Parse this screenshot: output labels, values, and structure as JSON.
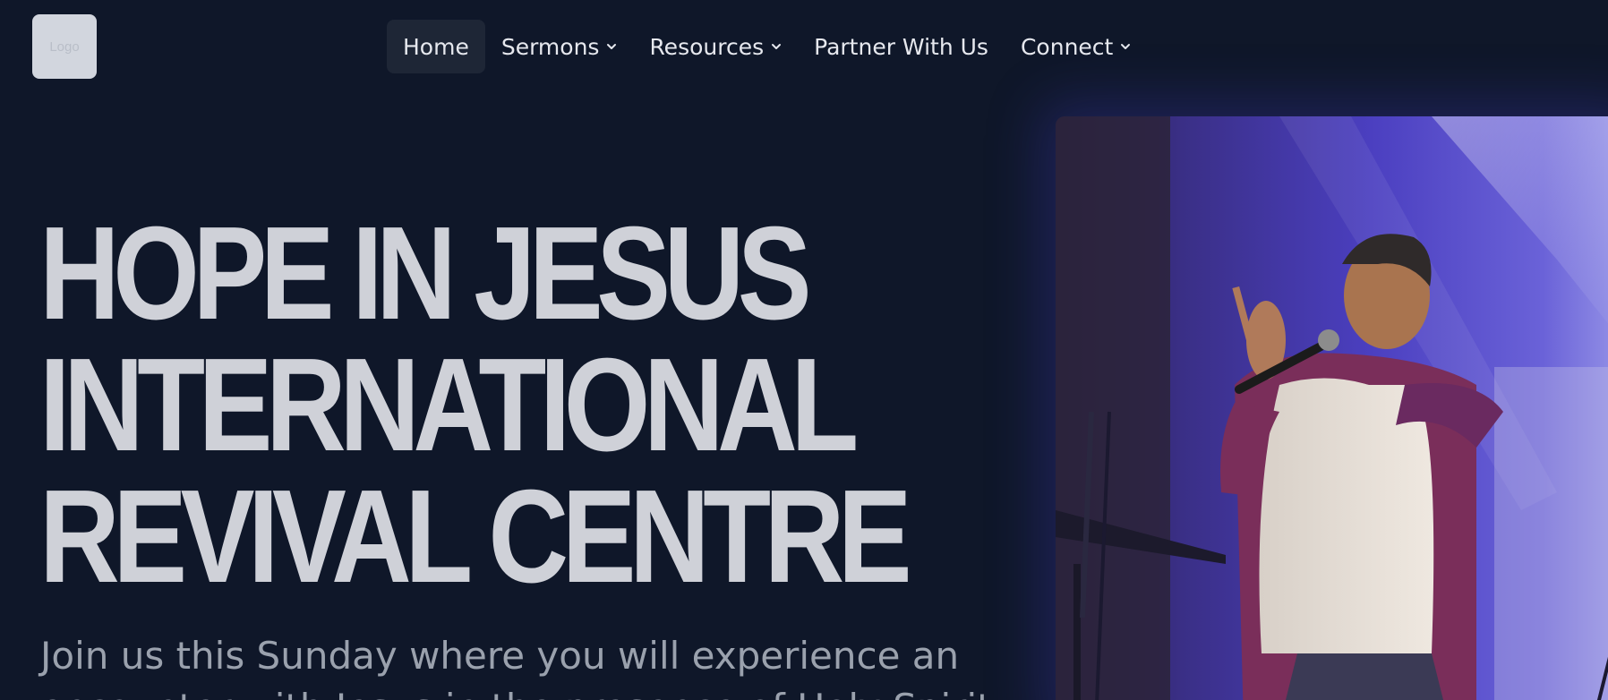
{
  "header": {
    "logo_text": "Logo",
    "nav": [
      {
        "label": "Home",
        "active": true,
        "has_dropdown": false
      },
      {
        "label": "Sermons",
        "active": false,
        "has_dropdown": true
      },
      {
        "label": "Resources",
        "active": false,
        "has_dropdown": true
      },
      {
        "label": "Partner With Us",
        "active": false,
        "has_dropdown": false
      },
      {
        "label": "Connect",
        "active": false,
        "has_dropdown": true
      }
    ]
  },
  "hero": {
    "title_lines": [
      "HOPE IN JESUS",
      "INTERNATIONAL",
      "REVIVAL CENTRE"
    ],
    "subtitle": "Join us this Sunday where you will experience an encounter with Jesus in the presence of Holy Spirit"
  },
  "icons": {
    "dropdown": "chevron-down-icon"
  },
  "colors": {
    "background": "#0f1729",
    "title": "#cfd1d8",
    "subtitle": "#9aa1ad",
    "nav_text": "#e6e8ee",
    "nav_active_bg": "#1e2636",
    "photo_glow": "#4a3fd0"
  }
}
